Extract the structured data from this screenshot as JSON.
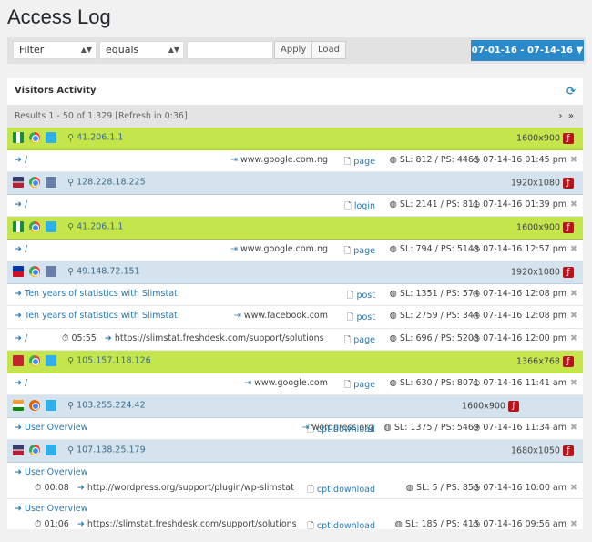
{
  "page_title": "Access Log",
  "filter": {
    "field": "Filter",
    "operator": "equals",
    "value": "",
    "apply_label": "Apply",
    "load_label": "Load",
    "date_range": "07-01-16 - 07-14-16 ▼"
  },
  "panel": {
    "title": "Visitors Activity",
    "results": "Results 1 - 50 of 1.329 [Refresh in 0:36]",
    "pager_next": "›",
    "pager_last": "»"
  },
  "visits": [
    {
      "ip": "41.206.1.1",
      "resolution": "1600x900",
      "type": "g",
      "hits": [
        {
          "resource": "/",
          "referrer": "www.google.com.ng",
          "content_type": "page",
          "sl_ps": "SL: 812 / PS: 4466",
          "time": "07-14-16 01:45 pm"
        }
      ]
    },
    {
      "ip": "128.228.18.225",
      "resolution": "1920x1080",
      "type": "b",
      "hits": [
        {
          "resource": "/",
          "referrer": "",
          "content_type": "login",
          "sl_ps": "SL: 2141 / PS: 811",
          "time": "07-14-16 01:39 pm"
        }
      ]
    },
    {
      "ip": "41.206.1.1",
      "resolution": "1600x900",
      "type": "g",
      "hits": [
        {
          "resource": "/",
          "referrer": "www.google.com.ng",
          "content_type": "page",
          "sl_ps": "SL: 794 / PS: 5148",
          "time": "07-14-16 12:57 pm"
        }
      ]
    },
    {
      "ip": "49.148.72.151",
      "resolution": "1920x1080",
      "type": "b",
      "hits": [
        {
          "resource": "Ten years of statistics with Slimstat",
          "referrer": "",
          "content_type": "post",
          "sl_ps": "SL: 1351 / PS: 574",
          "time": "07-14-16 12:08 pm"
        },
        {
          "resource": "Ten years of statistics with Slimstat",
          "referrer": "www.facebook.com",
          "content_type": "post",
          "sl_ps": "SL: 2759 / PS: 344",
          "time": "07-14-16 12:08 pm"
        },
        {
          "resource": "/",
          "duration": "05:55",
          "outbound": "https://slimstat.freshdesk.com/support/solutions",
          "content_type": "page",
          "sl_ps": "SL: 696 / PS: 5208",
          "time": "07-14-16 12:00 pm"
        }
      ]
    },
    {
      "ip": "105.157.118.126",
      "resolution": "1366x768",
      "type": "g",
      "hits": [
        {
          "resource": "/",
          "referrer": "www.google.com",
          "content_type": "page",
          "sl_ps": "SL: 630 / PS: 8071",
          "time": "07-14-16 11:41 am"
        }
      ]
    },
    {
      "ip": "103.255.224.42",
      "resolution": "1600x900",
      "type": "b",
      "hits": [
        {
          "resource": "User Overview",
          "referrer": "wordpress.org",
          "content_type": "cpt:download",
          "sl_ps": "SL: 1375 / PS: 5469",
          "time": "07-14-16 11:34 am"
        }
      ]
    },
    {
      "ip": "107.138.25.179",
      "resolution": "1680x1050",
      "type": "b",
      "hits": [
        {
          "resource": "User Overview",
          "duration": "00:08",
          "outbound": "http://wordpress.org/support/plugin/wp-slimstat",
          "content_type": "cpt:download",
          "sl_ps": "SL: 5 / PS: 856",
          "time": "07-14-16 10:00 am"
        },
        {
          "resource": "User Overview",
          "duration": "01:06",
          "outbound": "https://slimstat.freshdesk.com/support/solutions",
          "content_type": "cpt:download",
          "sl_ps": "SL: 185 / PS: 415",
          "time": "07-14-16 09:56 am"
        }
      ]
    }
  ]
}
